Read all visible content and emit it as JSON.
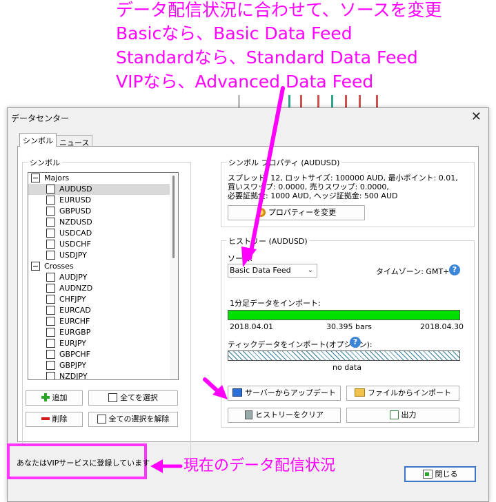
{
  "annotations": {
    "top_lines": [
      "データ配信状況に合わせて、ソースを変更",
      "Basicなら、Basic Data Feed",
      "Standardなら、Standard Data Feed",
      "VIPなら、Advanced Data Feed"
    ],
    "status_callout": "現在のデータ配信状況"
  },
  "dialog": {
    "title": "データセンター",
    "close_label": "✕",
    "tabs": [
      {
        "label": "シンボル",
        "active": true
      },
      {
        "label": "ニュース",
        "active": false
      }
    ]
  },
  "symbols": {
    "group_label": "シンボル",
    "groups": [
      {
        "name": "Majors",
        "items": [
          "AUDUSD",
          "EURUSD",
          "GBPUSD",
          "NZDUSD",
          "USDCAD",
          "USDCHF",
          "USDJPY"
        ]
      },
      {
        "name": "Crosses",
        "items": [
          "AUDJPY",
          "AUDNZD",
          "CHFJPY",
          "EURCAD",
          "EURCHF",
          "EURGBP",
          "EURJPY",
          "GBPCHF",
          "GBPJPY",
          "NZDJPY"
        ]
      }
    ],
    "selected": "AUDUSD",
    "buttons": {
      "add": "追加",
      "select_all": "全てを選択",
      "delete": "削除",
      "deselect_all": "全ての選択を解除"
    }
  },
  "properties": {
    "group_label": "シンボル プロパティ (AUDUSD)",
    "lines": [
      "スプレッド: 12, ロットサイズ: 100000 AUD, 最小ポイント: 0.01,",
      "買いスワップ: 0.0000, 売りスワップ: 0.0000,",
      "必要証拠金: 1000 AUD, ヘッジ証拠金: 500 AUD"
    ],
    "change_button": "プロパティーを変更"
  },
  "history": {
    "group_label": "ヒストリー (AUDUSD)",
    "source_label": "ソース:",
    "source_value": "Basic Data Feed",
    "timezone": "タイムゾーン: GMT+0",
    "help_glyph": "?",
    "minute_label": "1分足データをインポート:",
    "minute_progress": 1.0,
    "minute_start": "2018.04.01",
    "minute_bars": "30.395 bars",
    "minute_end": "2018.04.30",
    "tick_label": "ティックデータをインポート(オプション):",
    "tick_status": "no data",
    "buttons": {
      "update_server": "サーバーからアップデート",
      "import_file": "ファイルからインポート",
      "clear_history": "ヒストリーをクリア",
      "export": "出力"
    }
  },
  "status": {
    "text": "あなたはVIPサービスに登録しています"
  },
  "close_button": "閉じる",
  "colors": {
    "annotation": "#ff00ff",
    "progress": "#00e000"
  }
}
